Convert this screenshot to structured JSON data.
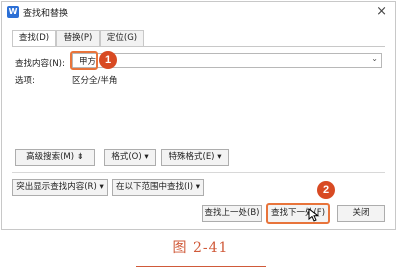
{
  "window": {
    "title": "查找和替换",
    "app_icon": "W",
    "close_glyph": "×"
  },
  "tabs": [
    {
      "label": "查找(D)",
      "active": true
    },
    {
      "label": "替换(P)",
      "active": false
    },
    {
      "label": "定位(G)",
      "active": false
    }
  ],
  "find": {
    "label": "查找内容(N):",
    "value": "甲方"
  },
  "options": {
    "label": "选项:",
    "value": "区分全/半角"
  },
  "buttons": {
    "advanced_search": "高级搜索(M) ⇟",
    "format": "格式(O) ▾",
    "special_format": "特殊格式(E) ▾",
    "highlight_all": "突出显示查找内容(R) ▾",
    "find_in": "在以下范围中查找(I) ▾",
    "find_previous": "查找上一处(B)",
    "find_next": "查找下一处(F)",
    "close": "关闭"
  },
  "callouts": {
    "step1": "1",
    "step2": "2"
  },
  "caption": "图 2-41",
  "colors": {
    "accent": "#e8743b",
    "callout": "#d84a23",
    "caption": "#d05a3a"
  }
}
